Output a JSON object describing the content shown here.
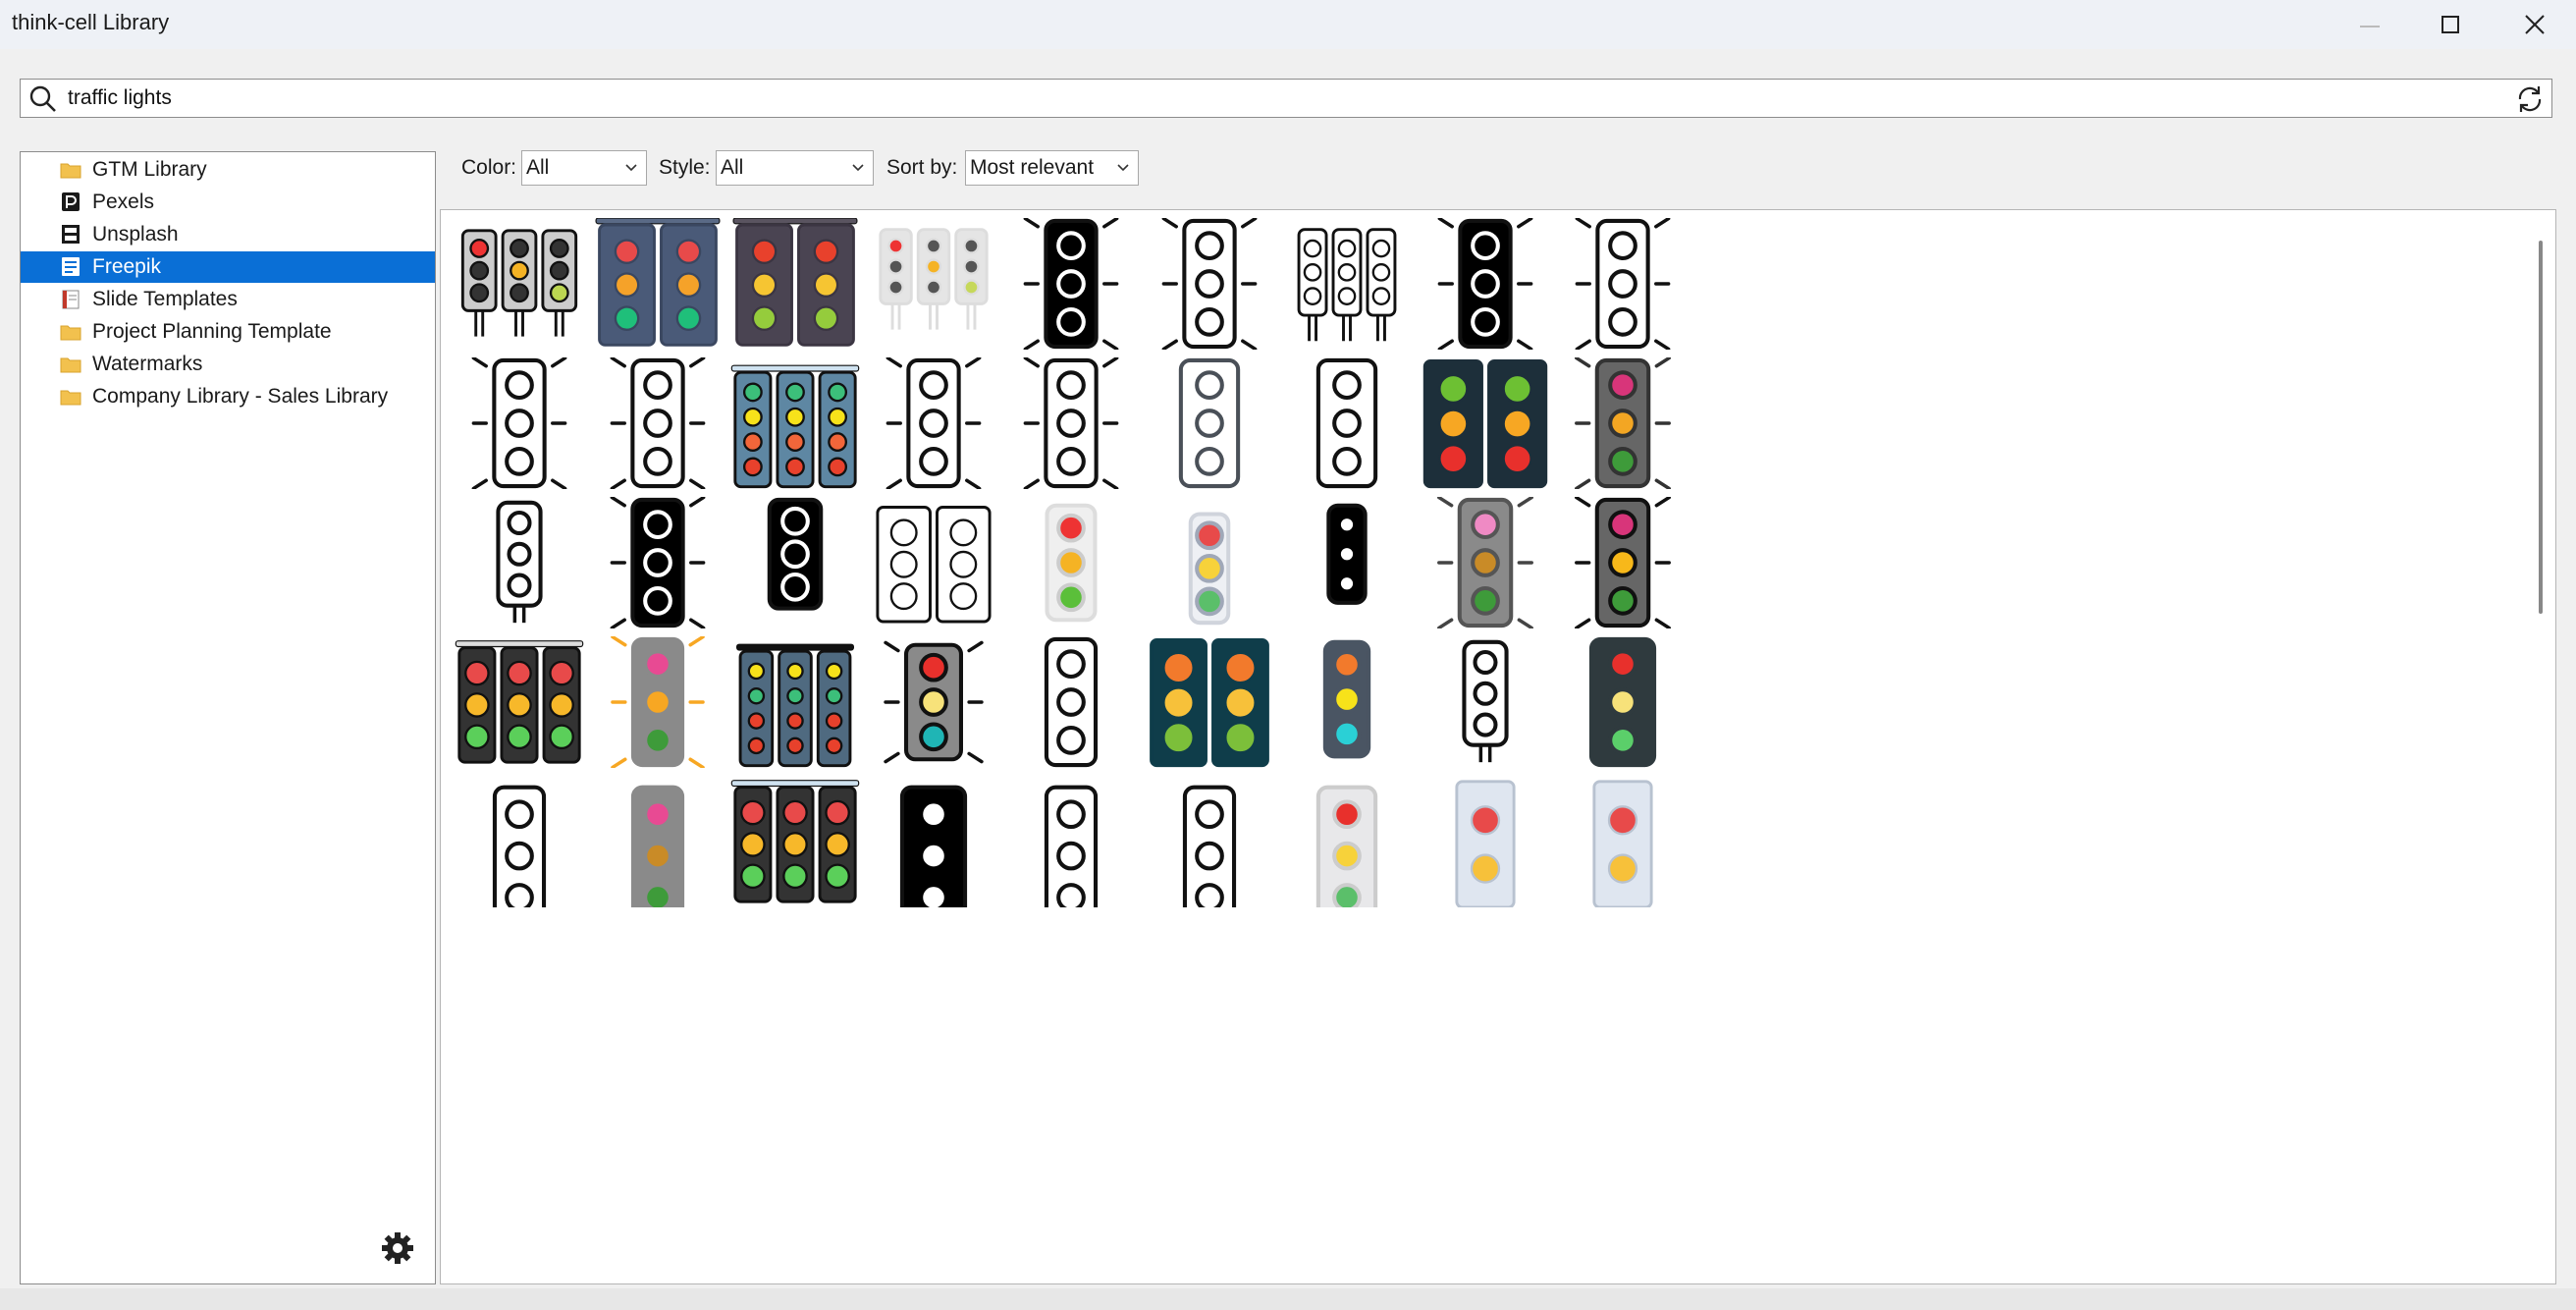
{
  "window": {
    "title": "think-cell Library"
  },
  "search": {
    "value": "traffic lights",
    "placeholder": ""
  },
  "sources": [
    {
      "label": "GTM Library",
      "icon": "folder-icon",
      "selected": false
    },
    {
      "label": "Pexels",
      "icon": "pexels-icon",
      "selected": false
    },
    {
      "label": "Unsplash",
      "icon": "unsplash-icon",
      "selected": false
    },
    {
      "label": "Freepik",
      "icon": "freepik-icon",
      "selected": true
    },
    {
      "label": "Slide Templates",
      "icon": "slide-templates-icon",
      "selected": false
    },
    {
      "label": "Project Planning Template",
      "icon": "folder-icon",
      "selected": false
    },
    {
      "label": "Watermarks",
      "icon": "folder-icon",
      "selected": false
    },
    {
      "label": "Company Library - Sales Library",
      "icon": "folder-icon",
      "selected": false
    }
  ],
  "filters": {
    "color_label": "Color:",
    "color_value": "All",
    "style_label": "Style:",
    "style_value": "All",
    "sort_label": "Sort by:",
    "sort_value": "Most relevant"
  },
  "colors": {
    "selection": "#0a6fd6",
    "folder": "#f2c14e"
  },
  "results": {
    "rows": [
      [
        "triple-icon-flat",
        "double-slate",
        "double-dark",
        "triple-pole-grey",
        "black-rays",
        "outline-rays",
        "triple-crossed",
        "black-rays",
        "outline-rays"
      ],
      [
        "outline-rays",
        "outline-rays",
        "triple-blue",
        "outline-rays",
        "outline-rays",
        "outline-grey",
        "outline",
        "double-dark-round",
        "grey-rays"
      ],
      [
        "outline-pole",
        "black-rays",
        "black-solid",
        "double-cyan",
        "3d-white",
        "3d-pole",
        "black-small",
        "grey-pink-rays",
        "black-yellow-rays"
      ],
      [
        "triple-arrows",
        "grey-orange-rays",
        "triple-blue-bar",
        "signal-waves",
        "outline-plain",
        "double-teal",
        "slate-cyan",
        "outline-pole",
        "dark-wings"
      ],
      [
        "outline-partial",
        "grey-partial",
        "triple-arrows-red",
        "black-partial",
        "outline-partial",
        "outline-partial",
        "3d-wings",
        "wings-red",
        "wings-red"
      ]
    ]
  }
}
